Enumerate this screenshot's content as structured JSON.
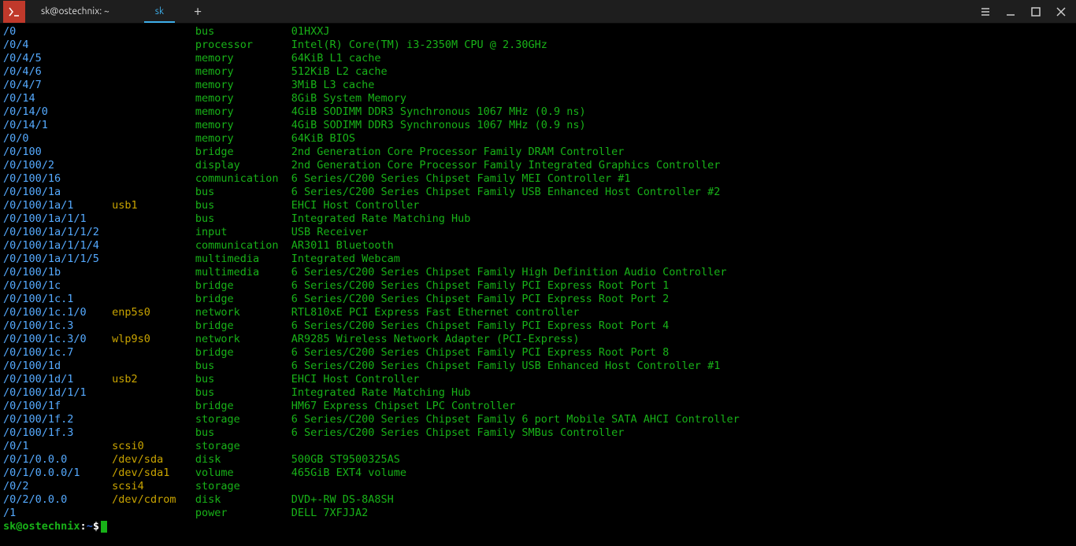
{
  "window": {
    "title": "sk@ostechnix: ~",
    "tab_label": "sk",
    "new_tab": "+"
  },
  "rows": [
    {
      "path": "/0",
      "device": "",
      "klass": "bus",
      "desc": "01HXXJ"
    },
    {
      "path": "/0/4",
      "device": "",
      "klass": "processor",
      "desc": "Intel(R) Core(TM) i3-2350M CPU @ 2.30GHz"
    },
    {
      "path": "/0/4/5",
      "device": "",
      "klass": "memory",
      "desc": "64KiB L1 cache"
    },
    {
      "path": "/0/4/6",
      "device": "",
      "klass": "memory",
      "desc": "512KiB L2 cache"
    },
    {
      "path": "/0/4/7",
      "device": "",
      "klass": "memory",
      "desc": "3MiB L3 cache"
    },
    {
      "path": "/0/14",
      "device": "",
      "klass": "memory",
      "desc": "8GiB System Memory"
    },
    {
      "path": "/0/14/0",
      "device": "",
      "klass": "memory",
      "desc": "4GiB SODIMM DDR3 Synchronous 1067 MHz (0.9 ns)"
    },
    {
      "path": "/0/14/1",
      "device": "",
      "klass": "memory",
      "desc": "4GiB SODIMM DDR3 Synchronous 1067 MHz (0.9 ns)"
    },
    {
      "path": "/0/0",
      "device": "",
      "klass": "memory",
      "desc": "64KiB BIOS"
    },
    {
      "path": "/0/100",
      "device": "",
      "klass": "bridge",
      "desc": "2nd Generation Core Processor Family DRAM Controller"
    },
    {
      "path": "/0/100/2",
      "device": "",
      "klass": "display",
      "desc": "2nd Generation Core Processor Family Integrated Graphics Controller"
    },
    {
      "path": "/0/100/16",
      "device": "",
      "klass": "communication",
      "desc": "6 Series/C200 Series Chipset Family MEI Controller #1"
    },
    {
      "path": "/0/100/1a",
      "device": "",
      "klass": "bus",
      "desc": "6 Series/C200 Series Chipset Family USB Enhanced Host Controller #2"
    },
    {
      "path": "/0/100/1a/1",
      "device": "usb1",
      "klass": "bus",
      "desc": "EHCI Host Controller"
    },
    {
      "path": "/0/100/1a/1/1",
      "device": "",
      "klass": "bus",
      "desc": "Integrated Rate Matching Hub"
    },
    {
      "path": "/0/100/1a/1/1/2",
      "device": "",
      "klass": "input",
      "desc": "USB Receiver"
    },
    {
      "path": "/0/100/1a/1/1/4",
      "device": "",
      "klass": "communication",
      "desc": "AR3011 Bluetooth"
    },
    {
      "path": "/0/100/1a/1/1/5",
      "device": "",
      "klass": "multimedia",
      "desc": "Integrated Webcam"
    },
    {
      "path": "/0/100/1b",
      "device": "",
      "klass": "multimedia",
      "desc": "6 Series/C200 Series Chipset Family High Definition Audio Controller"
    },
    {
      "path": "/0/100/1c",
      "device": "",
      "klass": "bridge",
      "desc": "6 Series/C200 Series Chipset Family PCI Express Root Port 1"
    },
    {
      "path": "/0/100/1c.1",
      "device": "",
      "klass": "bridge",
      "desc": "6 Series/C200 Series Chipset Family PCI Express Root Port 2"
    },
    {
      "path": "/0/100/1c.1/0",
      "device": "enp5s0",
      "klass": "network",
      "desc": "RTL810xE PCI Express Fast Ethernet controller"
    },
    {
      "path": "/0/100/1c.3",
      "device": "",
      "klass": "bridge",
      "desc": "6 Series/C200 Series Chipset Family PCI Express Root Port 4"
    },
    {
      "path": "/0/100/1c.3/0",
      "device": "wlp9s0",
      "klass": "network",
      "desc": "AR9285 Wireless Network Adapter (PCI-Express)"
    },
    {
      "path": "/0/100/1c.7",
      "device": "",
      "klass": "bridge",
      "desc": "6 Series/C200 Series Chipset Family PCI Express Root Port 8"
    },
    {
      "path": "/0/100/1d",
      "device": "",
      "klass": "bus",
      "desc": "6 Series/C200 Series Chipset Family USB Enhanced Host Controller #1"
    },
    {
      "path": "/0/100/1d/1",
      "device": "usb2",
      "klass": "bus",
      "desc": "EHCI Host Controller"
    },
    {
      "path": "/0/100/1d/1/1",
      "device": "",
      "klass": "bus",
      "desc": "Integrated Rate Matching Hub"
    },
    {
      "path": "/0/100/1f",
      "device": "",
      "klass": "bridge",
      "desc": "HM67 Express Chipset LPC Controller"
    },
    {
      "path": "/0/100/1f.2",
      "device": "",
      "klass": "storage",
      "desc": "6 Series/C200 Series Chipset Family 6 port Mobile SATA AHCI Controller"
    },
    {
      "path": "/0/100/1f.3",
      "device": "",
      "klass": "bus",
      "desc": "6 Series/C200 Series Chipset Family SMBus Controller"
    },
    {
      "path": "/0/1",
      "device": "scsi0",
      "klass": "storage",
      "desc": ""
    },
    {
      "path": "/0/1/0.0.0",
      "device": "/dev/sda",
      "klass": "disk",
      "desc": "500GB ST9500325AS"
    },
    {
      "path": "/0/1/0.0.0/1",
      "device": "/dev/sda1",
      "klass": "volume",
      "desc": "465GiB EXT4 volume"
    },
    {
      "path": "/0/2",
      "device": "scsi4",
      "klass": "storage",
      "desc": ""
    },
    {
      "path": "/0/2/0.0.0",
      "device": "/dev/cdrom",
      "klass": "disk",
      "desc": "DVD+-RW DS-8A8SH"
    },
    {
      "path": "/1",
      "device": "",
      "klass": "power",
      "desc": "DELL 7XFJJA2"
    }
  ],
  "prompt": {
    "user": "sk@ostechnix",
    "colon": ":",
    "cwd": "~",
    "symbol": "$"
  }
}
